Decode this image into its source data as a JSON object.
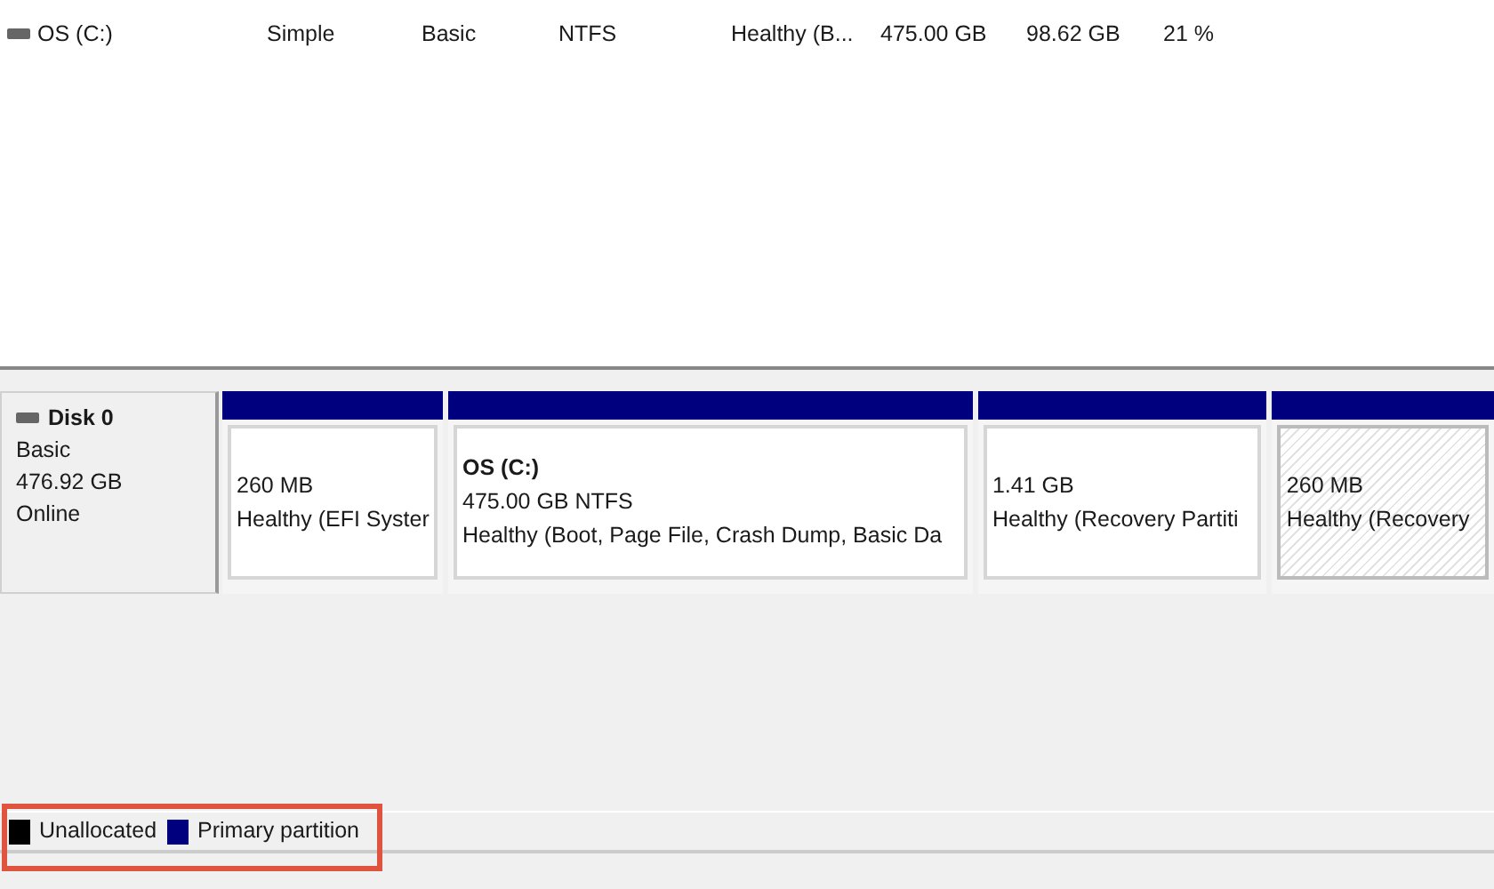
{
  "volume_list": {
    "rows": [
      {
        "volume": "OS (C:)",
        "layout": "Simple",
        "type": "Basic",
        "file_system": "NTFS",
        "status": "Healthy (B...",
        "capacity": "475.00 GB",
        "free_space": "98.62 GB",
        "percent_free": "21 %"
      }
    ]
  },
  "disks": [
    {
      "name": "Disk 0",
      "type": "Basic",
      "size": "476.92 GB",
      "state": "Online",
      "partitions": [
        {
          "size": "260 MB",
          "status": "Healthy (EFI Syster",
          "selected": false
        },
        {
          "label": "OS  (C:)",
          "size": "475.00 GB NTFS",
          "status": "Healthy (Boot, Page File, Crash Dump, Basic Da",
          "selected": false
        },
        {
          "size": "1.41 GB",
          "status": "Healthy (Recovery Partiti",
          "selected": false
        },
        {
          "size": "260 MB",
          "status": "Healthy (Recovery",
          "selected": true
        }
      ]
    }
  ],
  "legend": [
    {
      "label": "Unallocated",
      "color": "#000000"
    },
    {
      "label": "Primary partition",
      "color": "#00007f"
    }
  ],
  "legend_highlighted": true
}
